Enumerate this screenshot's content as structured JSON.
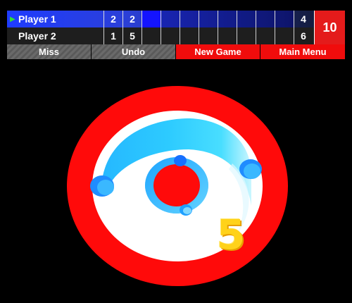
{
  "scoreboard": {
    "players": [
      {
        "name": "Player 1",
        "active": true,
        "frames": [
          "2",
          "2",
          "",
          "",
          "",
          "",
          "",
          "",
          "",
          ""
        ],
        "total": "4"
      },
      {
        "name": "Player 2",
        "active": false,
        "frames": [
          "1",
          "5",
          "",
          "",
          "",
          "",
          "",
          "",
          "",
          ""
        ],
        "total": "6"
      }
    ],
    "round": "10"
  },
  "buttons": {
    "miss": "Miss",
    "undo": "Undo",
    "new_game": "New Game",
    "main_menu": "Main Menu"
  },
  "last_throw_score": "5",
  "colors": {
    "active_row": "#1f3cff",
    "board_red": "#ff0a0a",
    "ring_cyan": "#19c8ff",
    "score_yellow": "#ffd21a"
  }
}
